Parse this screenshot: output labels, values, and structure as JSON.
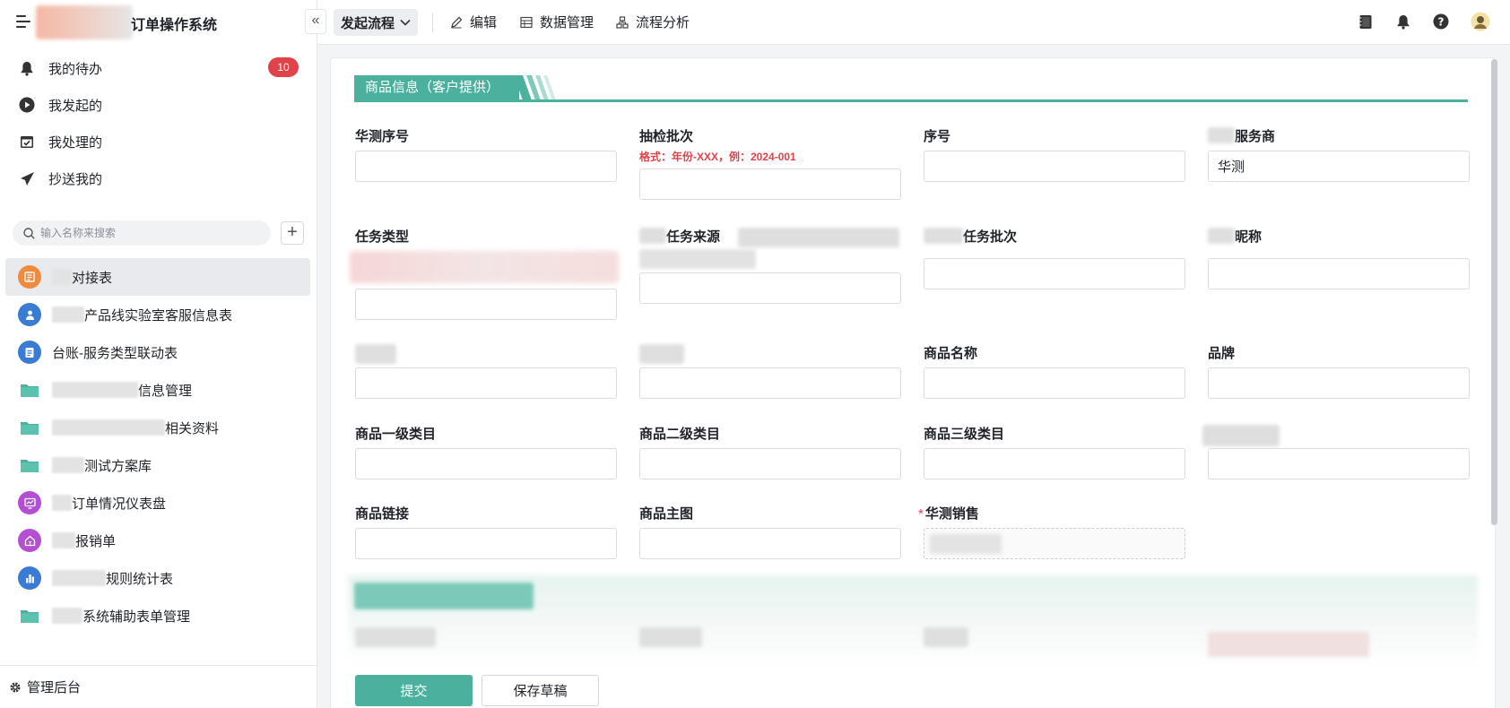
{
  "app": {
    "title": "订单操作系统"
  },
  "sidebar": {
    "nav": [
      {
        "label": "我的待办",
        "icon": "bell-icon"
      },
      {
        "label": "我发起的",
        "icon": "play-circle-icon"
      },
      {
        "label": "我处理的",
        "icon": "calendar-check-icon"
      },
      {
        "label": "抄送我的",
        "icon": "send-icon"
      }
    ],
    "todo_badge": "10",
    "search_placeholder": "输入名称来搜索",
    "add_label": "+",
    "items": [
      {
        "label": "对接表",
        "icon": "form-icon",
        "color": "#f08a3c"
      },
      {
        "label": "产品线实验室客服信息表",
        "icon": "people-icon",
        "color": "#3a7bd5"
      },
      {
        "label": "台账-服务类型联动表",
        "icon": "document-icon",
        "color": "#3a7bd5"
      },
      {
        "label": "信息管理",
        "icon": "folder-icon",
        "color": "#4bb19e"
      },
      {
        "label": "相关资料",
        "icon": "folder-icon",
        "color": "#4bb19e"
      },
      {
        "label": "测试方案库",
        "icon": "folder-icon",
        "color": "#4bb19e"
      },
      {
        "label": "订单情况仪表盘",
        "icon": "dashboard-icon",
        "color": "#b44fd3"
      },
      {
        "label": "报销单",
        "icon": "money-icon",
        "color": "#b44fd3"
      },
      {
        "label": "规则统计表",
        "icon": "bar-chart-icon",
        "color": "#3a7bd5"
      },
      {
        "label": "系统辅助表单管理",
        "icon": "folder-icon",
        "color": "#4bb19e"
      }
    ],
    "footer_label": "管理后台"
  },
  "topbar": {
    "start_flow": "发起流程",
    "edit": "编辑",
    "data_manage": "数据管理",
    "flow_analysis": "流程分析"
  },
  "form": {
    "section_title": "商品信息（客户提供）",
    "fields": {
      "serial_hc": {
        "label": "华测序号",
        "value": ""
      },
      "batch": {
        "label": "抽检批次",
        "hint": "格式：年份-XXX，例：2024-001",
        "value": ""
      },
      "seq": {
        "label": "序号",
        "value": ""
      },
      "provider": {
        "label": "服务商",
        "value": "华测"
      },
      "task_type": {
        "label": "任务类型",
        "value": ""
      },
      "task_source": {
        "label": "任务来源",
        "value": ""
      },
      "task_batch": {
        "label": "任务批次",
        "value": ""
      },
      "nickname": {
        "label": "昵称",
        "value": ""
      },
      "blur_a": {
        "value": ""
      },
      "blur_b": {
        "value": ""
      },
      "product_name": {
        "label": "商品名称",
        "value": ""
      },
      "brand": {
        "label": "品牌",
        "value": ""
      },
      "cat1": {
        "label": "商品一级类目",
        "value": ""
      },
      "cat2": {
        "label": "商品二级类目",
        "value": ""
      },
      "cat3": {
        "label": "商品三级类目",
        "value": ""
      },
      "blur_c": {
        "value": ""
      },
      "link": {
        "label": "商品链接",
        "value": ""
      },
      "main_image": {
        "label": "商品主图",
        "value": ""
      },
      "sales": {
        "label": "华测销售",
        "required_mark": "*"
      }
    },
    "submit": "提交",
    "save_draft": "保存草稿"
  }
}
